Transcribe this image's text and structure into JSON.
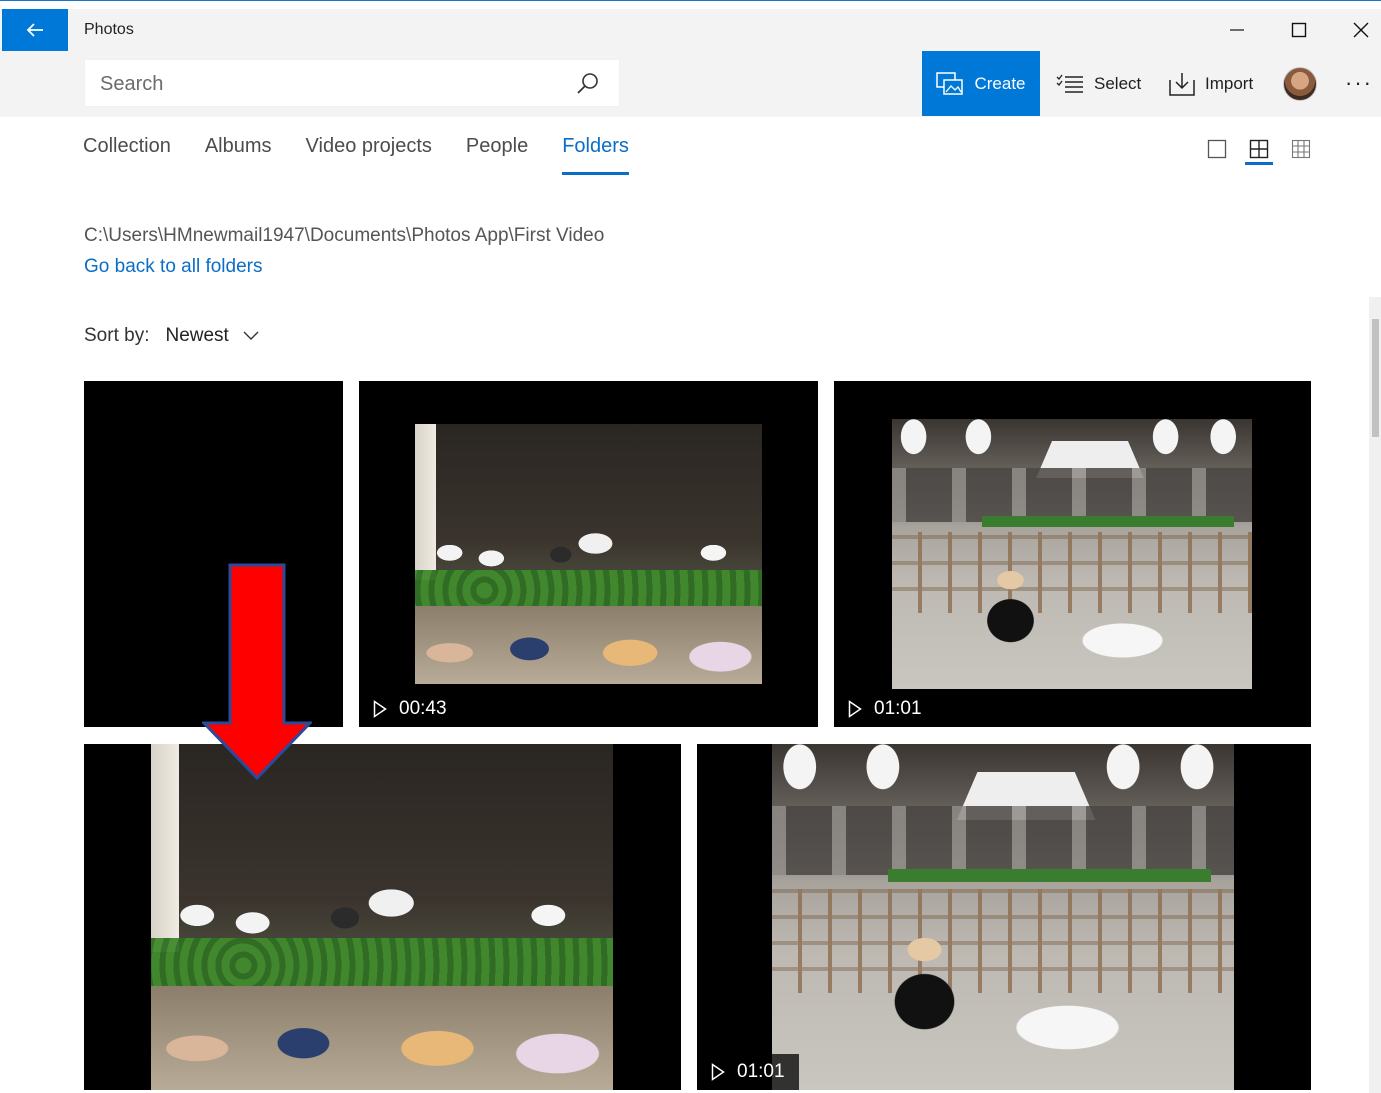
{
  "window": {
    "title": "Photos",
    "accent": "#0078d7"
  },
  "commandbar": {
    "search_placeholder": "Search",
    "create_label": "Create",
    "select_label": "Select",
    "import_label": "Import",
    "more_label": "···"
  },
  "tabs": [
    {
      "label": "Collection",
      "active": false
    },
    {
      "label": "Albums",
      "active": false
    },
    {
      "label": "Video projects",
      "active": false
    },
    {
      "label": "People",
      "active": false
    },
    {
      "label": "Folders",
      "active": true
    }
  ],
  "view_options": [
    "large-tiles",
    "medium-tiles",
    "small-tiles"
  ],
  "folder": {
    "path": "C:\\Users\\HMnewmail1947\\Documents\\Photos App\\First Video",
    "back_link": "Go back to all folders"
  },
  "sort": {
    "label": "Sort by:",
    "value": "Newest"
  },
  "items": [
    {
      "type": "video",
      "duration": "",
      "scene": "black"
    },
    {
      "type": "video",
      "duration": "00:43",
      "scene": "concert"
    },
    {
      "type": "video",
      "duration": "01:01",
      "scene": "cafe"
    },
    {
      "type": "video",
      "duration": "",
      "scene": "concert"
    },
    {
      "type": "video",
      "duration": "01:01",
      "scene": "cafe"
    }
  ],
  "annotation": {
    "arrow_color": "#ff0000",
    "arrow_outline": "#2b4a9a"
  }
}
